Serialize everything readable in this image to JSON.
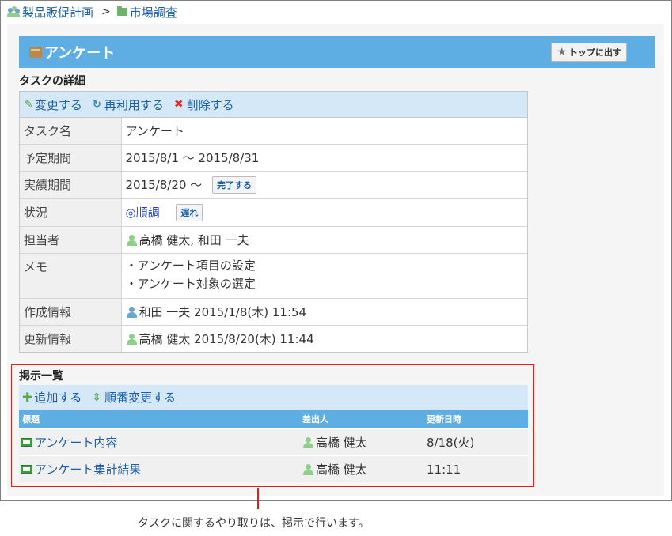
{
  "breadcrumb": {
    "space": "製品販促計画",
    "separator": ">",
    "folder": "市場調査"
  },
  "header": {
    "title": "アンケート",
    "top_button": "トップに出す"
  },
  "task_detail": {
    "section_title": "タスクの詳細",
    "actions": {
      "edit": "変更する",
      "reuse": "再利用する",
      "delete": "削除する"
    },
    "rows": {
      "name": {
        "label": "タスク名",
        "value": "アンケート"
      },
      "planned": {
        "label": "予定期間",
        "value": "2015/8/1 〜 2015/8/31"
      },
      "actual": {
        "label": "実績期間",
        "value": "2015/8/20 〜",
        "button": "完了する"
      },
      "status": {
        "label": "状況",
        "value": "◎順調",
        "button": "遅れ"
      },
      "assignee": {
        "label": "担当者",
        "value": "高橋 健太, 和田 一夫"
      },
      "memo": {
        "label": "メモ",
        "line1": "・アンケート項目の設定",
        "line2": "・アンケート対象の選定"
      },
      "created": {
        "label": "作成情報",
        "value": "和田 一夫 2015/1/8(木) 11:54"
      },
      "updated": {
        "label": "更新情報",
        "value": "高橋 健太 2015/8/20(木) 11:44"
      }
    }
  },
  "board": {
    "section_title": "掲示一覧",
    "actions": {
      "add": "追加する",
      "reorder": "順番変更する"
    },
    "columns": {
      "title": "標題",
      "sender": "差出人",
      "updated": "更新日時"
    },
    "rows": [
      {
        "title": "アンケート内容",
        "sender": "高橋 健太",
        "updated": "8/18(火)"
      },
      {
        "title": "アンケート集計結果",
        "sender": "高橋 健太",
        "updated": "11:11"
      }
    ]
  },
  "caption": "タスクに関するやり取りは、掲示で行います。",
  "colors": {
    "header_blue": "#5faee3",
    "action_bar": "#d4e8f7",
    "link": "#1a5ea6",
    "highlight_red": "#e0201b"
  }
}
